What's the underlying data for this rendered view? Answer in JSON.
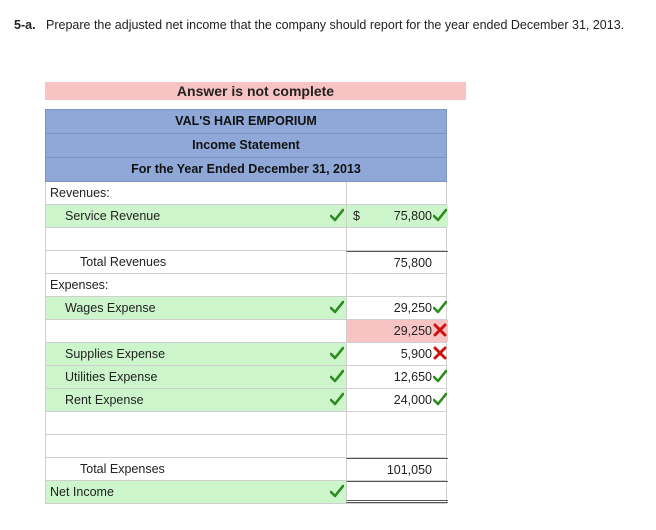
{
  "question": {
    "number": "5-a.",
    "text": "Prepare the adjusted net income that the company should report for the year ended December 31, 2013."
  },
  "banner": "Answer is not complete",
  "statement": {
    "company": "VAL'S HAIR EMPORIUM",
    "title": "Income Statement",
    "period": "For the Year Ended December 31, 2013",
    "rows": [
      {
        "label": "Revenues:",
        "amount": "",
        "dollar": "",
        "label_mark": "",
        "amount_mark": ""
      },
      {
        "label": "Service Revenue",
        "amount": "75,800",
        "dollar": "$",
        "label_mark": "check",
        "amount_mark": "check"
      },
      {
        "label": "",
        "amount": "",
        "dollar": "",
        "label_mark": "",
        "amount_mark": ""
      },
      {
        "label": "Total Revenues",
        "amount": "75,800",
        "dollar": "",
        "label_mark": "",
        "amount_mark": ""
      },
      {
        "label": "Expenses:",
        "amount": "",
        "dollar": "",
        "label_mark": "",
        "amount_mark": ""
      },
      {
        "label": "Wages Expense",
        "amount": "29,250",
        "dollar": "",
        "label_mark": "check",
        "amount_mark": "check"
      },
      {
        "label": "",
        "amount": "29,250",
        "dollar": "",
        "label_mark": "",
        "amount_mark": "cross"
      },
      {
        "label": "Supplies Expense",
        "amount": "5,900",
        "dollar": "",
        "label_mark": "check",
        "amount_mark": "cross"
      },
      {
        "label": "Utilities Expense",
        "amount": "12,650",
        "dollar": "",
        "label_mark": "check",
        "amount_mark": "check"
      },
      {
        "label": "Rent Expense",
        "amount": "24,000",
        "dollar": "",
        "label_mark": "check",
        "amount_mark": "check"
      },
      {
        "label": "",
        "amount": "",
        "dollar": "",
        "label_mark": "",
        "amount_mark": ""
      },
      {
        "label": "",
        "amount": "",
        "dollar": "",
        "label_mark": "",
        "amount_mark": ""
      },
      {
        "label": "Total Expenses",
        "amount": "101,050",
        "dollar": "",
        "label_mark": "",
        "amount_mark": ""
      },
      {
        "label": "Net Income",
        "amount": "",
        "dollar": "",
        "label_mark": "check",
        "amount_mark": ""
      }
    ]
  },
  "colors": {
    "header_blue": "#8fa8d8",
    "correct_green": "#ccf5cc",
    "incorrect_red": "#f8c3c3",
    "check_color": "#2e8b1e",
    "cross_color": "#cc1111"
  }
}
